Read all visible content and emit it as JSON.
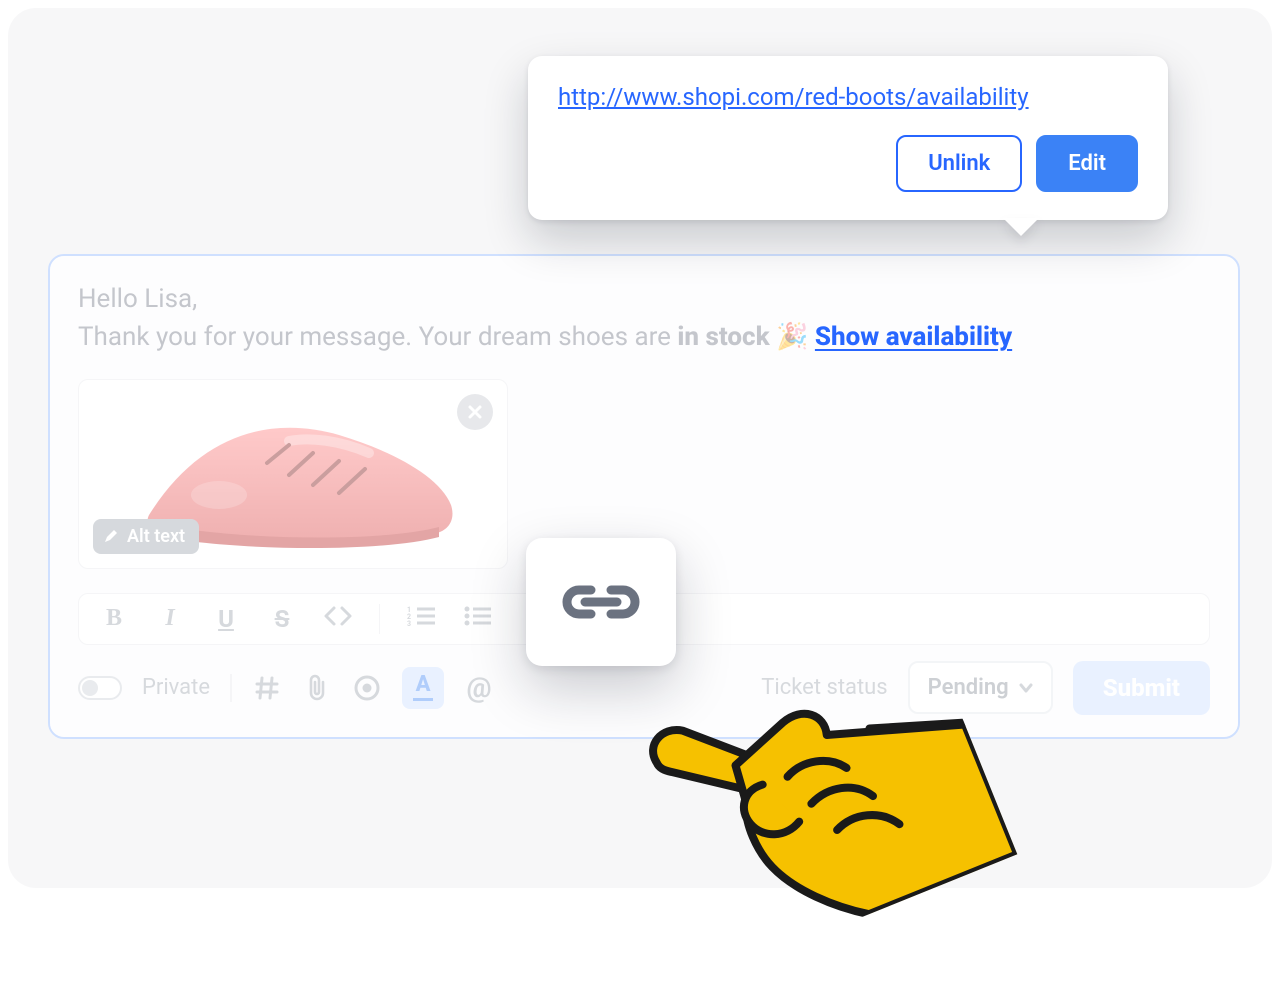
{
  "popover": {
    "url": "http://www.shopi.com/red-boots/availability",
    "unlink_label": "Unlink",
    "edit_label": "Edit"
  },
  "message": {
    "greeting": "Hello Lisa,",
    "line2_prefix": "Thank you for your message.  Your dream shoes are ",
    "in_stock": "in stock",
    "emoji": "🎉",
    "link_text": "Show availability"
  },
  "attachment": {
    "alt_label": "Alt text"
  },
  "footer": {
    "private_label": "Private",
    "ticket_status_label": "Ticket status",
    "status_value": "Pending",
    "submit_label": "Submit"
  },
  "colors": {
    "brand_blue": "#3b82f6",
    "link_blue": "#2766ff",
    "muted": "#9aa1aa"
  }
}
